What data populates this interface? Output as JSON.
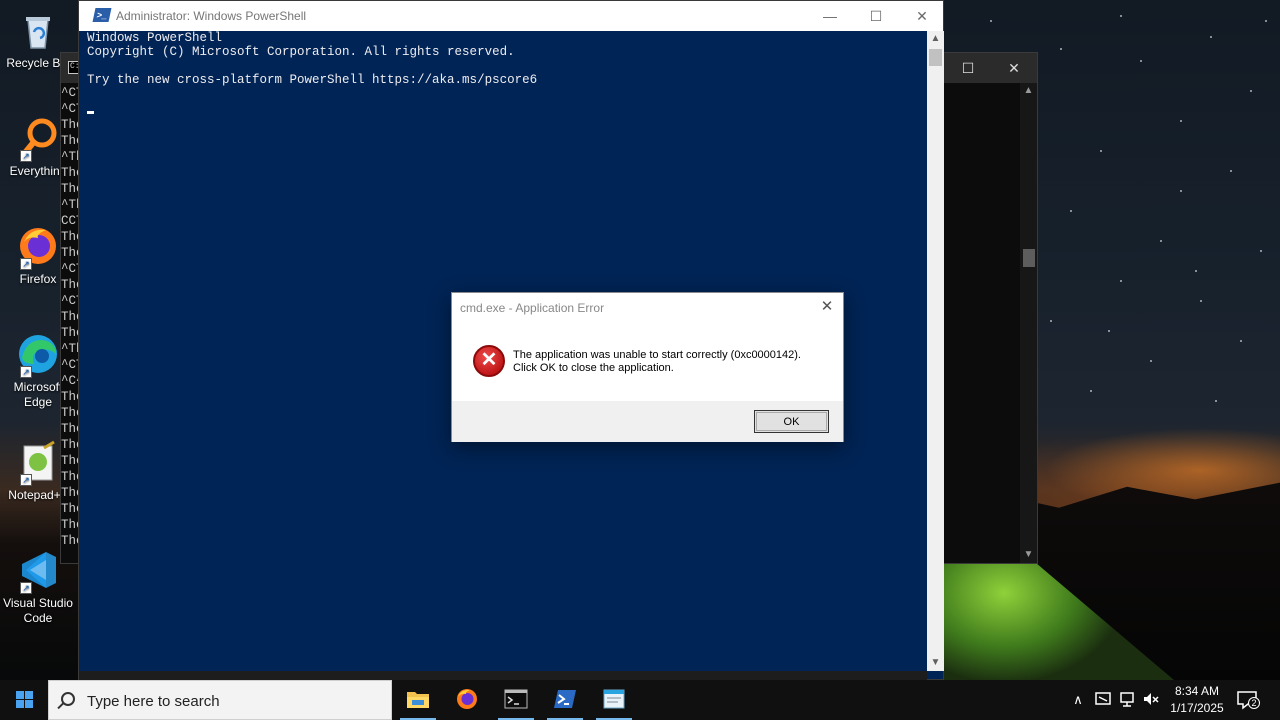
{
  "desktop": {
    "icons": [
      {
        "label": "Recycle Bin",
        "icon": "recycle-bin-icon"
      },
      {
        "label": "Everything",
        "icon": "everything-search-icon"
      },
      {
        "label": "Firefox",
        "icon": "firefox-icon"
      },
      {
        "label": "Microsoft Edge",
        "icon": "edge-icon"
      },
      {
        "label": "Notepad++",
        "icon": "notepadpp-icon"
      },
      {
        "label": "Visual Studio Code",
        "icon": "vscode-icon"
      }
    ]
  },
  "cmd_window": {
    "lines": [
      "^CT",
      "^CT",
      "The",
      "The",
      "^Th",
      "The",
      "The",
      "^Th",
      "CCT",
      "The",
      "The",
      "^CT",
      "The",
      "^CT",
      "The",
      "The",
      "^Th",
      "^CT",
      "^C^",
      "The",
      "The",
      "The",
      "The",
      "The",
      "The",
      "The",
      "The",
      "The",
      "The"
    ]
  },
  "powershell": {
    "title": "Administrator: Windows PowerShell",
    "console_lines": [
      "Windows PowerShell",
      "Copyright (C) Microsoft Corporation. All rights reserved.",
      "",
      "Try the new cross-platform PowerShell https://aka.ms/pscore6"
    ]
  },
  "dialog": {
    "title": "cmd.exe - Application Error",
    "message_line1": "The application was unable to start correctly (0xc0000142).",
    "message_line2": "Click OK to close the application.",
    "ok_label": "OK",
    "icon": "error-icon"
  },
  "taskbar": {
    "search_placeholder": "Type here to search",
    "apps": [
      "file-explorer-icon",
      "firefox-icon",
      "terminal-icon",
      "powershell-icon",
      "notepad-icon"
    ],
    "time": "8:34 AM",
    "date": "1/17/2025",
    "notification_count": "2",
    "colors": {
      "accent": "#76b9ed",
      "powershell_bg": "#012456"
    }
  }
}
